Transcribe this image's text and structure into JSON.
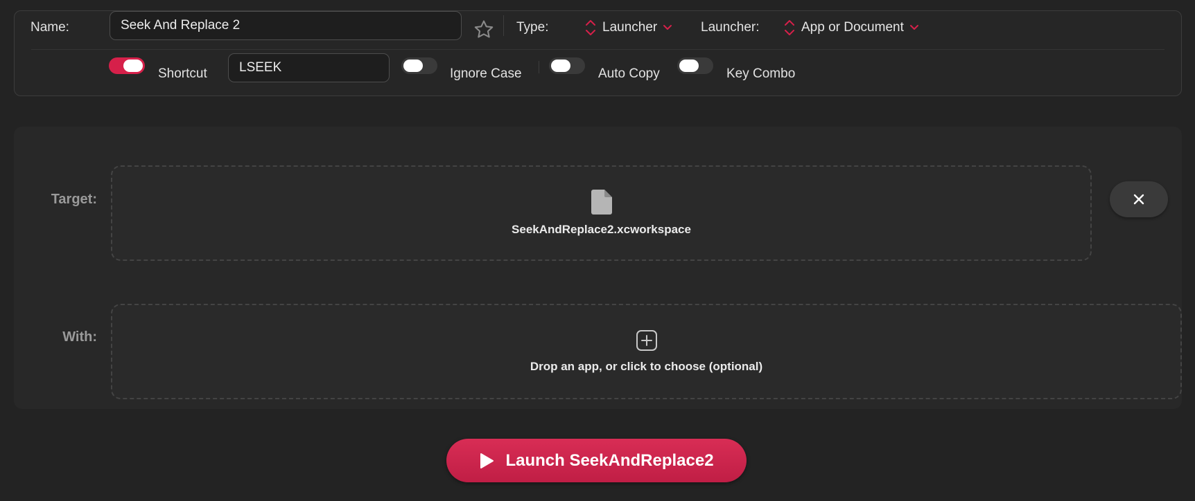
{
  "settings": {
    "name_label": "Name:",
    "name_value": "Seek And Replace 2",
    "type_label": "Type:",
    "type_value": "Launcher",
    "launcher_label": "Launcher:",
    "launcher_value": "App or Document",
    "shortcut_enabled": true,
    "shortcut_label": "Shortcut",
    "shortcut_value": "LSEEK",
    "ignore_case_label": "Ignore Case",
    "ignore_case_enabled": false,
    "auto_copy_label": "Auto Copy",
    "auto_copy_enabled": false,
    "key_combo_label": "Key Combo",
    "key_combo_enabled": false
  },
  "target": {
    "label": "Target:",
    "file_name": "SeekAndReplace2.xcworkspace",
    "icon": "document-icon"
  },
  "with": {
    "label": "With:",
    "placeholder": "Drop an app, or click to choose (optional)",
    "icon": "plus-square-icon"
  },
  "launch": {
    "label": "Launch SeekAndReplace2",
    "icon": "play-icon"
  },
  "colors": {
    "accent": "#d6204a",
    "background": "#232323"
  }
}
